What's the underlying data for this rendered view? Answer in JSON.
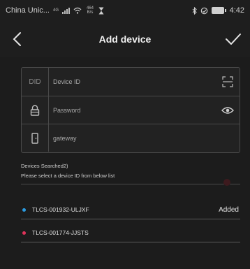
{
  "status_bar": {
    "carrier": "China Unic...",
    "network": "4G",
    "speed": "464 B/s",
    "time": "4:42"
  },
  "header": {
    "title": "Add device",
    "back_icon": "back-chevron-icon",
    "confirm_icon": "checkmark-icon"
  },
  "form": {
    "device_id": {
      "icon_text": "DID",
      "placeholder": "Device ID",
      "value": "",
      "action_icon": "scan-icon"
    },
    "password": {
      "icon": "lock-icon",
      "placeholder": "Password",
      "value": "",
      "action_icon": "eye-icon"
    },
    "gateway": {
      "icon": "door-icon",
      "placeholder": "gateway",
      "value": ""
    }
  },
  "search": {
    "title": "Devices Searched2)",
    "hint": "Please select a device ID from below list"
  },
  "devices": [
    {
      "name": "TLCS-001932-ULJXF",
      "status": "Added",
      "dot_color": "#2b9be0"
    },
    {
      "name": "TLCS-001774-JJSTS",
      "status": "",
      "dot_color": "#e0335a"
    }
  ],
  "colors": {
    "background": "#1c1c1c",
    "border": "#4a4a4a",
    "text": "#e6e6e6"
  }
}
